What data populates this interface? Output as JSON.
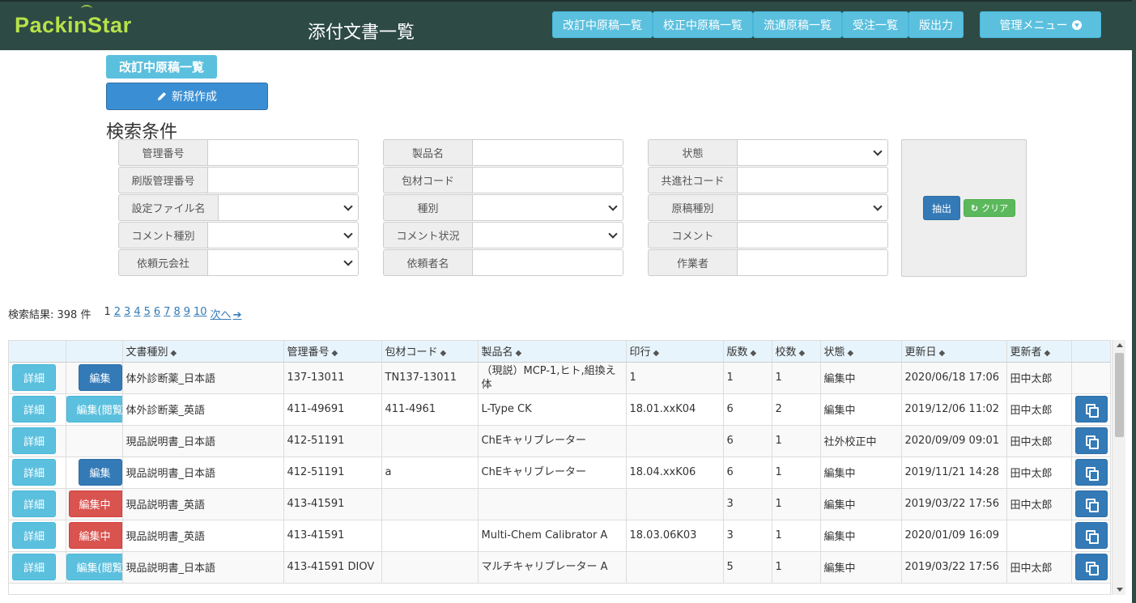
{
  "header": {
    "logo": "PackinStar",
    "title": "添付文書一覧",
    "nav": [
      {
        "label": "改訂中原稿一覧"
      },
      {
        "label": "校正中原稿一覧"
      },
      {
        "label": "流通原稿一覧"
      },
      {
        "label": "受注一覧"
      },
      {
        "label": "版出力"
      },
      {
        "label": "管理メニュー"
      }
    ]
  },
  "section_label": "改訂中原稿一覧",
  "new_button": "新規作成",
  "search": {
    "heading": "検索条件",
    "fields": [
      {
        "label": "管理番号",
        "value": ""
      },
      {
        "label": "刷版管理番号",
        "value": ""
      },
      {
        "label": "設定ファイル名",
        "value": ""
      },
      {
        "label": "コメント種別",
        "value": ""
      },
      {
        "label": "依頼元会社",
        "value": ""
      },
      {
        "label": "製品名",
        "value": ""
      },
      {
        "label": "包材コード",
        "value": ""
      },
      {
        "label": "種別",
        "value": ""
      },
      {
        "label": "コメント状況",
        "value": ""
      },
      {
        "label": "依頼者名",
        "value": ""
      },
      {
        "label": "状態",
        "value": ""
      },
      {
        "label": "共進社コード",
        "value": ""
      },
      {
        "label": "原稿種別",
        "value": ""
      },
      {
        "label": "コメント",
        "value": ""
      },
      {
        "label": "作業者",
        "value": ""
      }
    ],
    "extract_label": "抽出",
    "clear_label": "クリア"
  },
  "results": {
    "summary": "検索結果: 398 件",
    "current_page": "1",
    "pages": [
      "2",
      "3",
      "4",
      "5",
      "6",
      "7",
      "8",
      "9",
      "10"
    ],
    "next_label": "次へ"
  },
  "table": {
    "headers": [
      "文書種別",
      "管理番号",
      "包材コード",
      "製品名",
      "印行",
      "版数",
      "校数",
      "状態",
      "更新日",
      "更新者"
    ],
    "detail_label": "詳細",
    "rows": [
      {
        "edit": "編集",
        "edit_type": "edit",
        "doc_type": "体外診断薬_日本語",
        "mgmt_no": "137-13011",
        "code": "TN137-13011",
        "product": "（現説）MCP-1,ヒト,組換え体",
        "print": "1",
        "edition": "1",
        "proof": "1",
        "status": "編集中",
        "updated": "2020/06/18 17:06",
        "updater": "田中太郎",
        "copy": false
      },
      {
        "edit": "編集(閲覧)",
        "edit_type": "view",
        "doc_type": "体外診断薬_英語",
        "mgmt_no": "411-49691",
        "code": "411-4961",
        "product": "L-Type CK",
        "print": "18.01.xxK04",
        "edition": "6",
        "proof": "2",
        "status": "編集中",
        "updated": "2019/12/06 11:02",
        "updater": "田中太郎",
        "copy": true
      },
      {
        "edit": "",
        "edit_type": "none",
        "doc_type": "現品説明書_日本語",
        "mgmt_no": "412-51191",
        "code": "",
        "product": "ChEキャリブレーター",
        "print": "",
        "edition": "6",
        "proof": "1",
        "status": "社外校正中",
        "updated": "2020/09/09 09:01",
        "updater": "田中太郎",
        "copy": true
      },
      {
        "edit": "編集",
        "edit_type": "edit",
        "doc_type": "現品説明書_日本語",
        "mgmt_no": "412-51191",
        "code": "a",
        "product": "ChEキャリブレーター",
        "print": "18.04.xxK06",
        "edition": "6",
        "proof": "1",
        "status": "編集中",
        "updated": "2019/11/21 14:28",
        "updater": "田中太郎",
        "copy": true
      },
      {
        "edit": "編集中",
        "edit_type": "editing",
        "doc_type": "現品説明書_英語",
        "mgmt_no": "413-41591",
        "code": "",
        "product": "",
        "print": "",
        "edition": "3",
        "proof": "1",
        "status": "編集中",
        "updated": "2019/03/22 17:56",
        "updater": "田中太郎",
        "copy": true
      },
      {
        "edit": "編集中",
        "edit_type": "editing",
        "doc_type": "現品説明書_英語",
        "mgmt_no": "413-41591",
        "code": "",
        "product": "Multi-Chem Calibrator A",
        "print": "18.03.06K03",
        "edition": "3",
        "proof": "1",
        "status": "編集中",
        "updated": "2020/01/09 16:09",
        "updater": "",
        "copy": true
      },
      {
        "edit": "編集(閲覧)",
        "edit_type": "view",
        "doc_type": "現品説明書_日本語",
        "mgmt_no": "413-41591 DIOV",
        "code": "",
        "product": "マルチキャリブレーター A",
        "print": "",
        "edition": "5",
        "proof": "1",
        "status": "編集中",
        "updated": "2019/03/22 17:56",
        "updater": "田中太郎",
        "copy": true
      }
    ]
  }
}
